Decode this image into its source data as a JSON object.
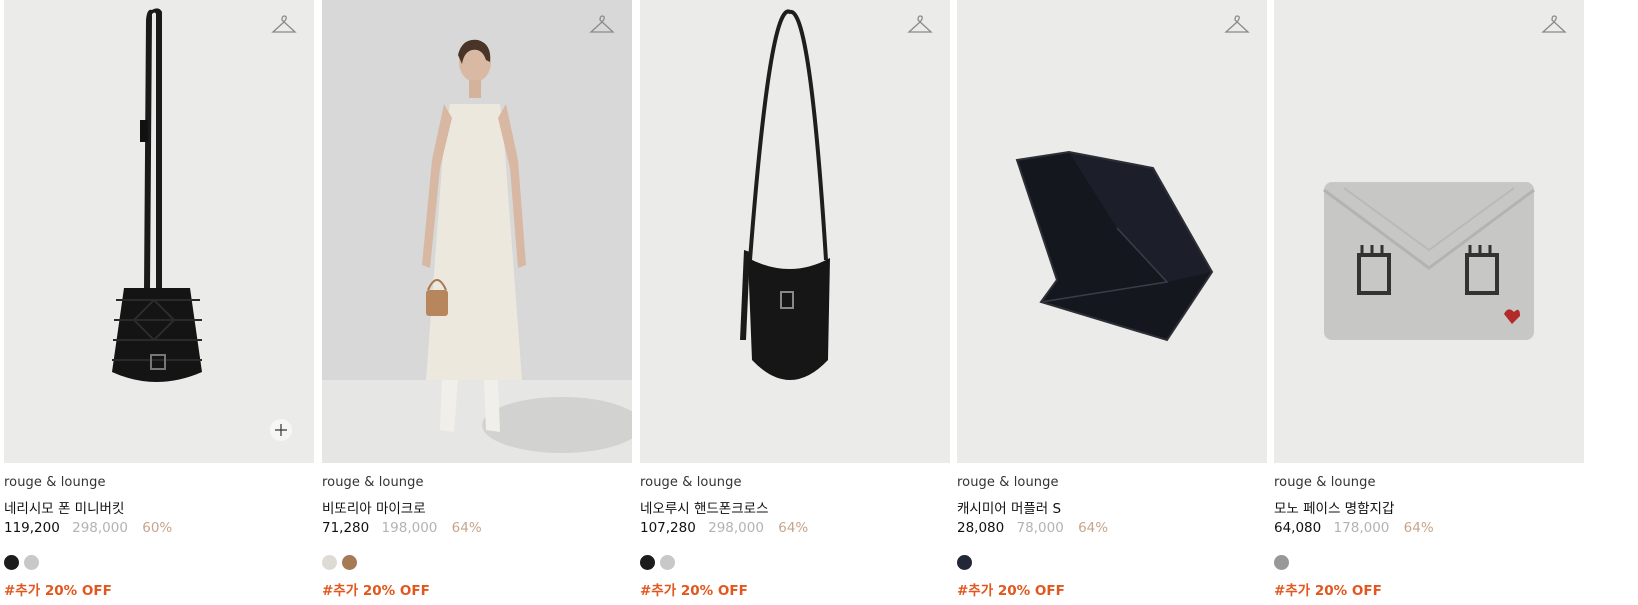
{
  "products": [
    {
      "brand": "rouge & lounge",
      "name": "네리시모 폰 미니버킷",
      "sale_price": "119,200",
      "original_price": "298,000",
      "discount": "60%",
      "promo": "#추가 20% OFF",
      "swatches": [
        "#1c1c1c",
        "#c8c8c8"
      ],
      "icons": [
        "hanger-icon",
        "plus-icon"
      ]
    },
    {
      "brand": "rouge & lounge",
      "name": "비또리아 마이크로",
      "sale_price": "71,280",
      "original_price": "198,000",
      "discount": "64%",
      "promo": "#추가 20% OFF",
      "swatches": [
        "#dedbd4",
        "#a57a55"
      ],
      "icons": [
        "hanger-icon"
      ]
    },
    {
      "brand": "rouge & lounge",
      "name": "네오루시 핸드폰크로스",
      "sale_price": "107,280",
      "original_price": "298,000",
      "discount": "64%",
      "promo": "#추가 20% OFF",
      "swatches": [
        "#1c1c1c",
        "#c8c8c8"
      ],
      "icons": [
        "hanger-icon"
      ]
    },
    {
      "brand": "rouge & lounge",
      "name": "캐시미어 머플러 S",
      "sale_price": "28,080",
      "original_price": "78,000",
      "discount": "64%",
      "promo": "#추가 20% OFF",
      "swatches": [
        "#232839"
      ],
      "icons": [
        "hanger-icon"
      ]
    },
    {
      "brand": "rouge & lounge",
      "name": "모노 페이스 명함지갑",
      "sale_price": "64,080",
      "original_price": "178,000",
      "discount": "64%",
      "promo": "#추가 20% OFF",
      "swatches": [
        "#9a9896"
      ],
      "icons": [
        "hanger-icon"
      ]
    }
  ],
  "colors": {
    "thumb_bg": "#ebebe9",
    "original_price": "#b3b3b3",
    "discount": "#c8a58a",
    "promo": "#e2571e"
  }
}
